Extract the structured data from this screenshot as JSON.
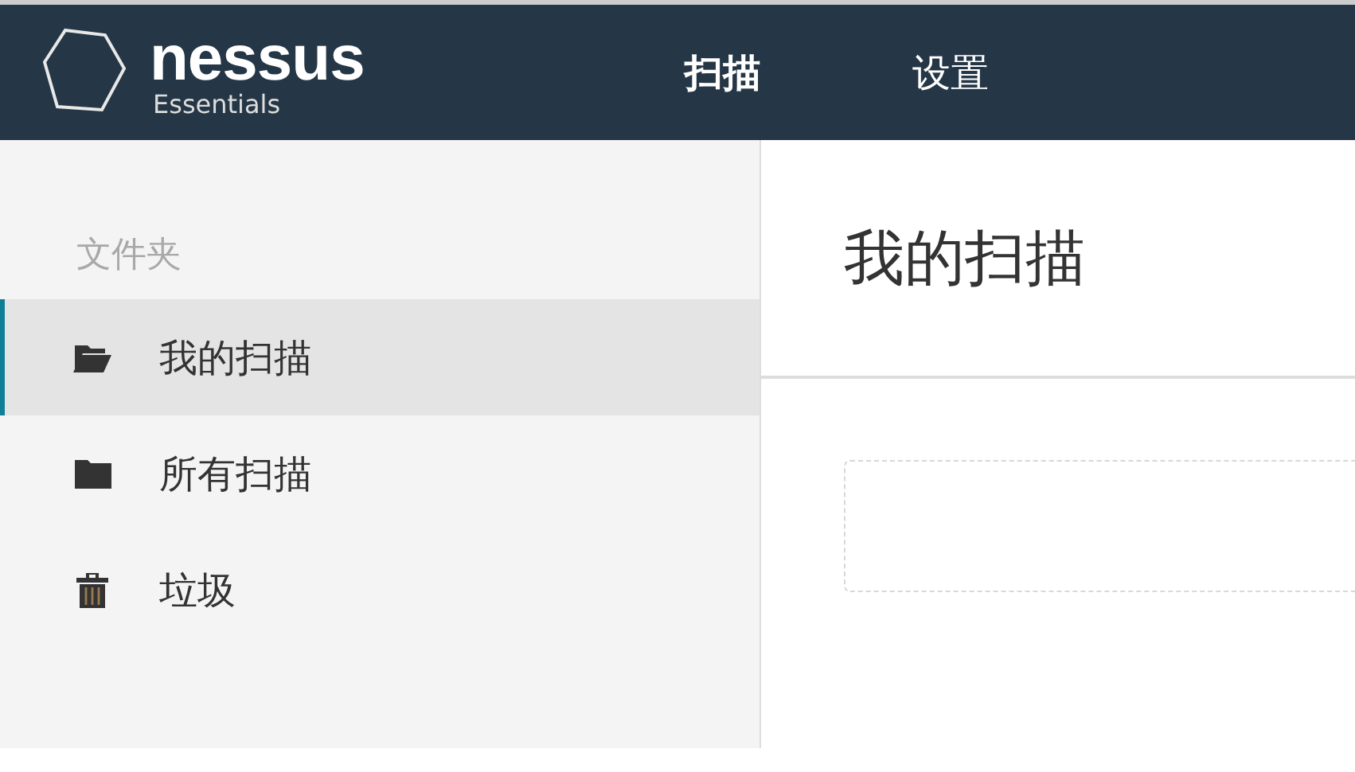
{
  "header": {
    "logo": {
      "name": "nessus",
      "edition": "Essentials"
    },
    "nav": [
      {
        "label": "扫描",
        "selected": true
      },
      {
        "label": "设置",
        "selected": false
      }
    ]
  },
  "sidebar": {
    "section": "文件夹",
    "items": [
      {
        "label": "我的扫描",
        "kind": "open-folder",
        "selected": true
      },
      {
        "label": "所有扫描",
        "kind": "folder",
        "selected": false
      },
      {
        "label": "垃圾",
        "kind": "trash",
        "selected": false
      }
    ]
  },
  "main": {
    "title": "我的扫描"
  }
}
